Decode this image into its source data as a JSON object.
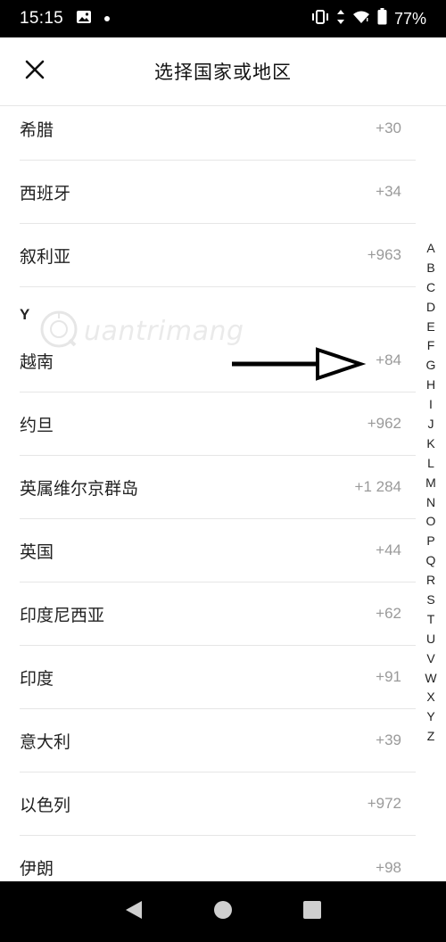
{
  "status_bar": {
    "time": "15:15",
    "battery_percent": "77%",
    "icons": [
      "gallery-icon",
      "notification-dot",
      "vibrate-icon",
      "data-arrows-icon",
      "wifi-icon",
      "battery-icon"
    ]
  },
  "header": {
    "title": "选择国家或地区",
    "close_icon": "close-icon"
  },
  "watermark": {
    "text": "uantrimang"
  },
  "list": {
    "rows": [
      {
        "name": "希腊",
        "code": "+30"
      },
      {
        "name": "西班牙",
        "code": "+34"
      },
      {
        "name": "叙利亚",
        "code": "+963"
      },
      {
        "name": "越南",
        "code": "+84"
      },
      {
        "name": "约旦",
        "code": "+962"
      },
      {
        "name": "英属维尔京群岛",
        "code": "+1 284"
      },
      {
        "name": "英国",
        "code": "+44"
      },
      {
        "name": "印度尼西亚",
        "code": "+62"
      },
      {
        "name": "印度",
        "code": "+91"
      },
      {
        "name": "意大利",
        "code": "+39"
      },
      {
        "name": "以色列",
        "code": "+972"
      },
      {
        "name": "伊朗",
        "code": "+98"
      }
    ],
    "section_letter": "Y"
  },
  "index_bar": {
    "letters": [
      "A",
      "B",
      "C",
      "D",
      "E",
      "F",
      "G",
      "H",
      "I",
      "J",
      "K",
      "L",
      "M",
      "N",
      "O",
      "P",
      "Q",
      "R",
      "S",
      "T",
      "U",
      "V",
      "W",
      "X",
      "Y",
      "Z"
    ]
  },
  "colors": {
    "code_gray": "#9a9a9a",
    "divider": "#e6e6e6",
    "status_bar_bg": "#000000"
  }
}
